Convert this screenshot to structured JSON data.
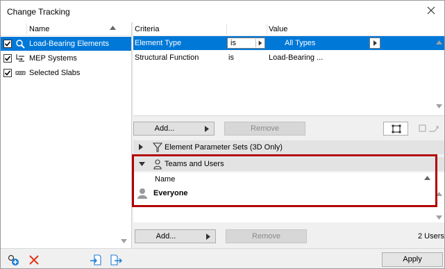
{
  "window": {
    "title": "Change Tracking"
  },
  "sets_list": {
    "column_name": "Name",
    "items": [
      {
        "label": "Load-Bearing Elements",
        "checked": true,
        "icon": "magnifier-icon",
        "selected": true
      },
      {
        "label": "MEP Systems",
        "checked": true,
        "icon": "mep-icon",
        "selected": false
      },
      {
        "label": "Selected Slabs",
        "checked": true,
        "icon": "slab-icon",
        "selected": false
      }
    ]
  },
  "criteria": {
    "columns": {
      "criteria": "Criteria",
      "value": "Value"
    },
    "rows": [
      {
        "criteria": "Element Type",
        "operator": "is",
        "value": "All Types"
      },
      {
        "criteria": "Structural Function",
        "operator": "is",
        "value": "Load-Bearing ..."
      }
    ],
    "add_label": "Add...",
    "remove_label": "Remove"
  },
  "sections": {
    "parameter_sets": "Element Parameter Sets (3D Only)",
    "teams_users": "Teams and Users"
  },
  "users": {
    "column_name": "Name",
    "rows": [
      {
        "label": "Everyone"
      }
    ],
    "add_label": "Add...",
    "remove_label": "Remove",
    "count": "2 Users"
  },
  "footer": {
    "apply_label": "Apply"
  },
  "colors": {
    "selection": "#0078d7",
    "highlight": "#b00000"
  }
}
